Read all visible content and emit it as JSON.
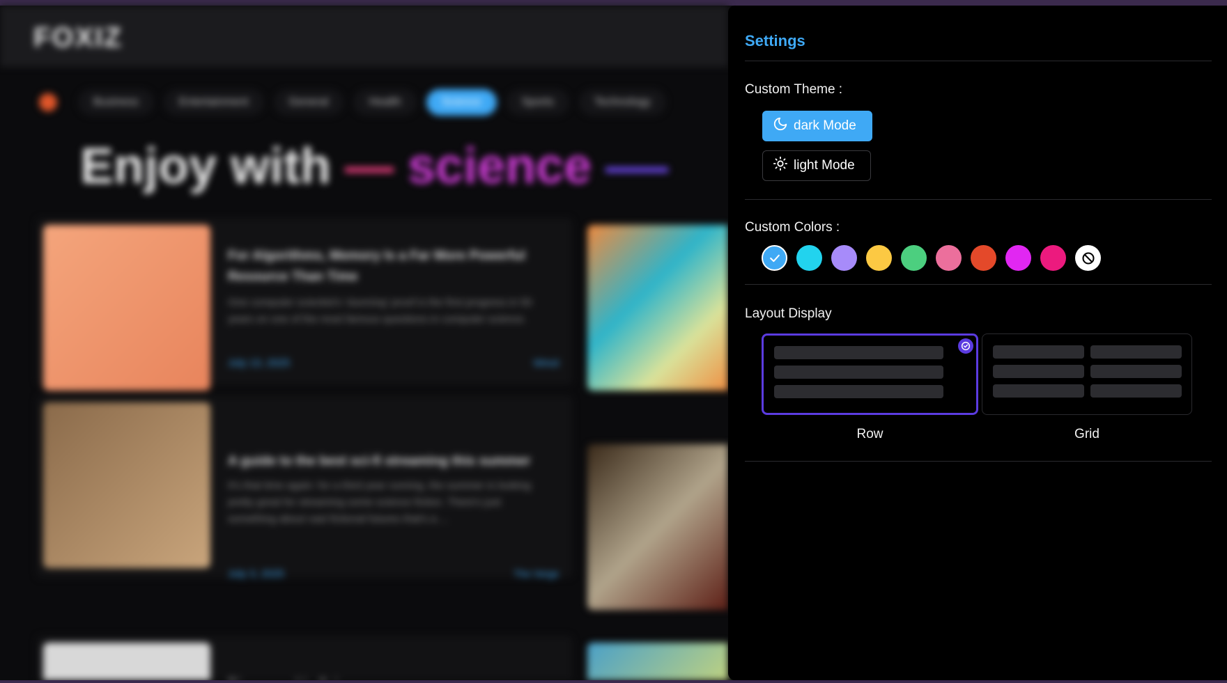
{
  "background": {
    "logo": "FOXIZ",
    "nav": [
      "Business",
      "Entertainment",
      "General",
      "Health",
      "Science",
      "Sports",
      "Technology"
    ],
    "active_nav": "Science",
    "hero": {
      "prefix": "Enjoy with",
      "highlight": "science"
    },
    "articles": [
      {
        "title": "For Algorithms, Memory Is a Far More Powerful Resource Than Time",
        "desc": "One computer scientist's 'stunning' proof is the first progress in 50 years on one of the most famous questions in computer science.",
        "date": "July 13, 2025",
        "tag": "Wired"
      },
      {
        "title": "A guide to the best sci-fi streaming this summer",
        "desc": "It's that time again: for a third year running, the summer is looking pretty great for streaming some science fiction. There's just something about vast fictional futures that's a ...",
        "date": "July 3, 2025",
        "tag": "The Verge"
      },
      {
        "title": "Discovered in Science",
        "desc": "",
        "date": "",
        "tag": ""
      }
    ]
  },
  "settings": {
    "title": "Settings",
    "theme": {
      "label": "Custom Theme :",
      "dark_label": "dark Mode",
      "light_label": "light Mode",
      "selected": "dark"
    },
    "colors": {
      "label": "Custom Colors :",
      "swatches": [
        "#3fa9f5",
        "#22d3ee",
        "#a78bfa",
        "#fcc943",
        "#4ccf7f",
        "#ec6f9c",
        "#e4492a",
        "#e127f2",
        "#ec1a7e",
        "none"
      ],
      "selected_index": 0
    },
    "layout": {
      "label": "Layout Display",
      "row_label": "Row",
      "grid_label": "Grid",
      "selected": "row"
    },
    "accent": "#3fa9f5",
    "selection_color": "#5b3be0"
  }
}
